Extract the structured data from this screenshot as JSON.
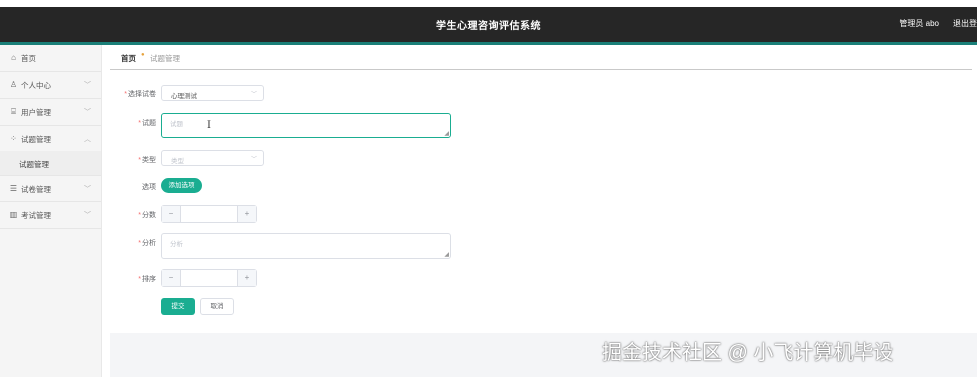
{
  "header": {
    "title": "学生心理咨询评估系统",
    "user_label": "管理员 abo",
    "logout_label": "退出登录"
  },
  "sidebar": {
    "items": [
      {
        "icon": "home-icon",
        "glyph": "⌂",
        "label": "首页",
        "has_chevron": false
      },
      {
        "icon": "user-icon",
        "glyph": "♙",
        "label": "个人中心",
        "has_chevron": true
      },
      {
        "icon": "bank-icon",
        "glyph": "⌸",
        "label": "用户管理",
        "has_chevron": true
      },
      {
        "icon": "grid-icon",
        "glyph": "⁘",
        "label": "试题管理",
        "has_chevron": true,
        "expanded": true
      },
      {
        "icon": "list-icon",
        "glyph": "☰",
        "label": "试卷管理",
        "has_chevron": true
      },
      {
        "icon": "chart-icon",
        "glyph": "▥",
        "label": "考试管理",
        "has_chevron": true
      }
    ],
    "active_subitem": "试题管理"
  },
  "breadcrumb": {
    "home": "首页",
    "current": "试题管理"
  },
  "form": {
    "paper": {
      "label": "选择试卷",
      "value": "心理测试"
    },
    "question": {
      "label": "试题",
      "placeholder": "试题"
    },
    "type": {
      "label": "类型",
      "placeholder": "类型"
    },
    "options": {
      "label": "选项",
      "add_button": "添加选项"
    },
    "score": {
      "label": "分数",
      "minus": "−",
      "plus": "+"
    },
    "analysis": {
      "label": "分析",
      "placeholder": "分析"
    },
    "order": {
      "label": "排序",
      "minus": "−",
      "plus": "+"
    },
    "submit_label": "提交",
    "cancel_label": "取消"
  },
  "watermark": "掘金技术社区 @ 小飞计算机毕设",
  "colors": {
    "topbar": "#262626",
    "accent": "#1a7f78",
    "primary_button": "#1aad91",
    "required_mark": "#f56c6c"
  }
}
